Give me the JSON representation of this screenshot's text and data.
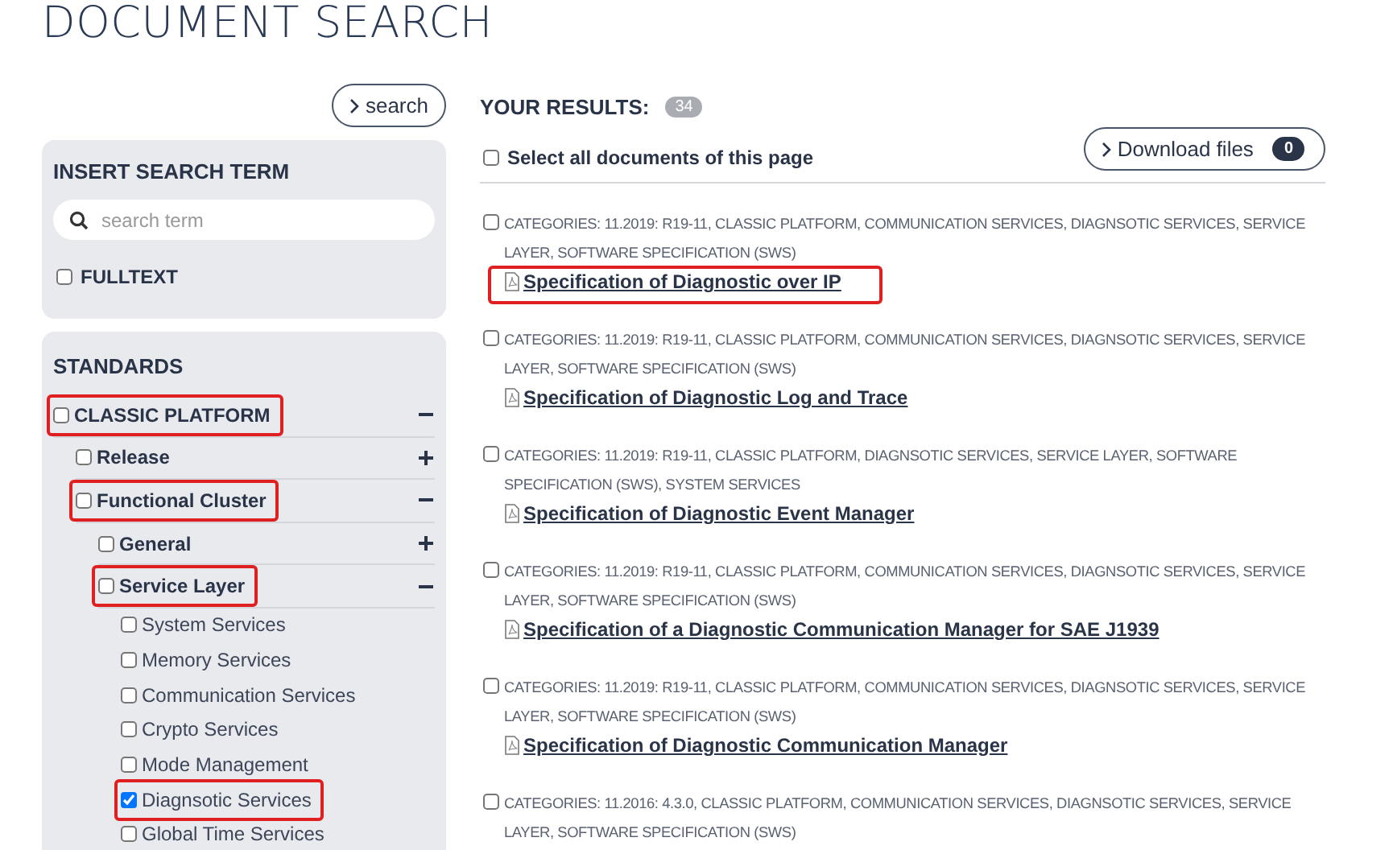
{
  "page_title": "DOCUMENT SEARCH",
  "search_button": "search",
  "search_panel": {
    "heading": "INSERT SEARCH TERM",
    "placeholder": "search term",
    "fulltext": {
      "label": "FULLTEXT",
      "checked": false
    }
  },
  "standards": {
    "heading": "STANDARDS",
    "tree": [
      {
        "label": "CLASSIC PLATFORM",
        "checked": false,
        "expanded": true,
        "highlighted": true,
        "children": [
          {
            "label": "Release",
            "checked": false,
            "expanded": false,
            "highlighted": false
          },
          {
            "label": "Functional Cluster",
            "checked": false,
            "expanded": true,
            "highlighted": true,
            "children": [
              {
                "label": "General",
                "checked": false,
                "expanded": false,
                "highlighted": false
              },
              {
                "label": "Service Layer",
                "checked": false,
                "expanded": true,
                "highlighted": true,
                "children": [
                  {
                    "label": "System Services",
                    "checked": false,
                    "highlighted": false
                  },
                  {
                    "label": "Memory Services",
                    "checked": false,
                    "highlighted": false
                  },
                  {
                    "label": "Communication Services",
                    "checked": false,
                    "highlighted": false
                  },
                  {
                    "label": "Crypto Services",
                    "checked": false,
                    "highlighted": false
                  },
                  {
                    "label": "Mode Management",
                    "checked": false,
                    "highlighted": false
                  },
                  {
                    "label": "Diagnsotic Services",
                    "checked": true,
                    "highlighted": true
                  },
                  {
                    "label": "Global Time Services",
                    "checked": false,
                    "highlighted": false
                  }
                ]
              }
            ]
          }
        ]
      }
    ]
  },
  "results": {
    "heading": "YOUR RESULTS:",
    "count": "34",
    "select_all": {
      "label": "Select all documents of this page",
      "checked": false
    },
    "download": {
      "label": "Download files",
      "count": "0"
    },
    "items": [
      {
        "categories": "CATEGORIES: 11.2019: R19-11, CLASSIC PLATFORM, COMMUNICATION SERVICES, DIAGNSOTIC SERVICES, SERVICE LAYER, SOFTWARE SPECIFICATION (SWS)",
        "title": "Specification of Diagnostic over IP",
        "checked": false,
        "highlighted": true
      },
      {
        "categories": "CATEGORIES: 11.2019: R19-11, CLASSIC PLATFORM, COMMUNICATION SERVICES, DIAGNSOTIC SERVICES, SERVICE LAYER, SOFTWARE SPECIFICATION (SWS)",
        "title": "Specification of Diagnostic Log and Trace",
        "checked": false,
        "highlighted": false
      },
      {
        "categories": "CATEGORIES: 11.2019: R19-11, CLASSIC PLATFORM, DIAGNSOTIC SERVICES, SERVICE LAYER, SOFTWARE SPECIFICATION (SWS), SYSTEM SERVICES",
        "title": "Specification of Diagnostic Event Manager",
        "checked": false,
        "highlighted": false
      },
      {
        "categories": "CATEGORIES: 11.2019: R19-11, CLASSIC PLATFORM, COMMUNICATION SERVICES, DIAGNSOTIC SERVICES, SERVICE LAYER, SOFTWARE SPECIFICATION (SWS)",
        "title": "Specification of a Diagnostic Communication Manager for SAE J1939",
        "checked": false,
        "highlighted": false
      },
      {
        "categories": "CATEGORIES: 11.2019: R19-11, CLASSIC PLATFORM, COMMUNICATION SERVICES, DIAGNSOTIC SERVICES, SERVICE LAYER, SOFTWARE SPECIFICATION (SWS)",
        "title": "Specification of Diagnostic Communication Manager",
        "checked": false,
        "highlighted": false
      },
      {
        "categories": "CATEGORIES: 11.2016: 4.3.0, CLASSIC PLATFORM, COMMUNICATION SERVICES, DIAGNSOTIC SERVICES, SERVICE LAYER, SOFTWARE SPECIFICATION (SWS)",
        "checked": false
      }
    ]
  }
}
